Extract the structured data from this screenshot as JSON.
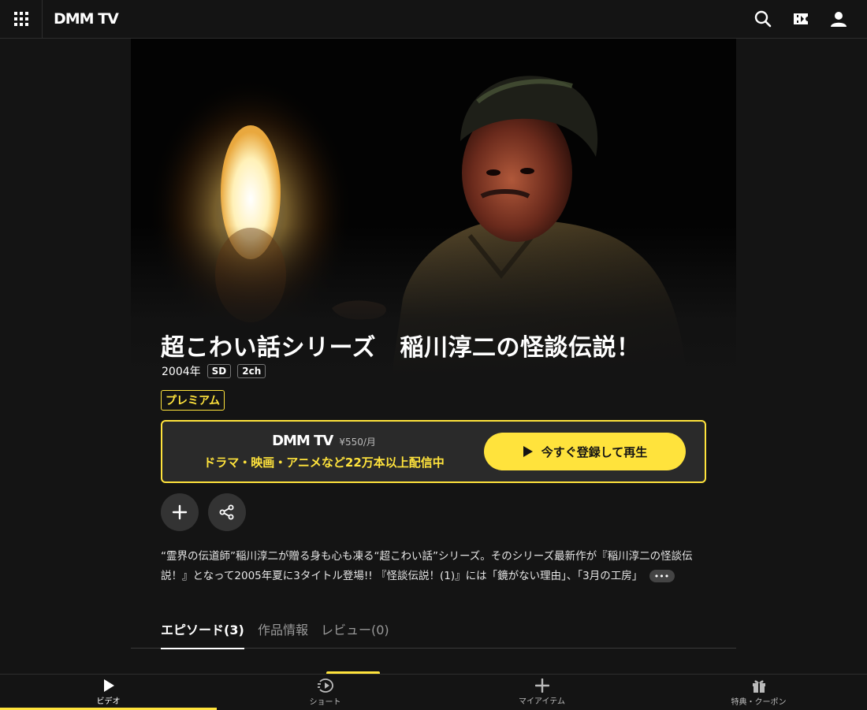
{
  "header": {
    "logo": "DMM TV",
    "icons": [
      "grid-menu-icon",
      "search-icon",
      "ticket-icon",
      "user-icon"
    ]
  },
  "title": "超こわい話シリーズ　稲川淳二の怪談伝説！",
  "meta": {
    "year": "2004年",
    "badges": [
      "SD",
      "2ch"
    ]
  },
  "plan_badge": "プレミアム",
  "promo": {
    "logo": "DMM TV",
    "price": "¥550/月",
    "tagline": "ドラマ・映画・アニメなど22万本以上配信中",
    "cta": "今すぐ登録して再生"
  },
  "description": "“霊界の伝道師”稲川淳二が贈る身も心も凍る“超こわい話”シリーズ。そのシリーズ最新作が『稲川淳二の怪談伝説！』となって2005年夏に3タイトル登場!! 『怪談伝説！(1)』には「鏡がない理由」、「3月の工房」",
  "more_label": "•••",
  "tabs": [
    {
      "label": "エピソード(3)"
    },
    {
      "label": "作品情報"
    },
    {
      "label": "レビュー(0)"
    }
  ],
  "bottom_nav": [
    {
      "label": "ビデオ",
      "icon": "play-icon"
    },
    {
      "label": "ショート",
      "icon": "short-play-icon"
    },
    {
      "label": "マイアイテム",
      "icon": "plus-icon"
    },
    {
      "label": "特典・クーポン",
      "icon": "gift-icon"
    }
  ],
  "colors": {
    "accent": "#ffe33c",
    "background": "#141414"
  }
}
